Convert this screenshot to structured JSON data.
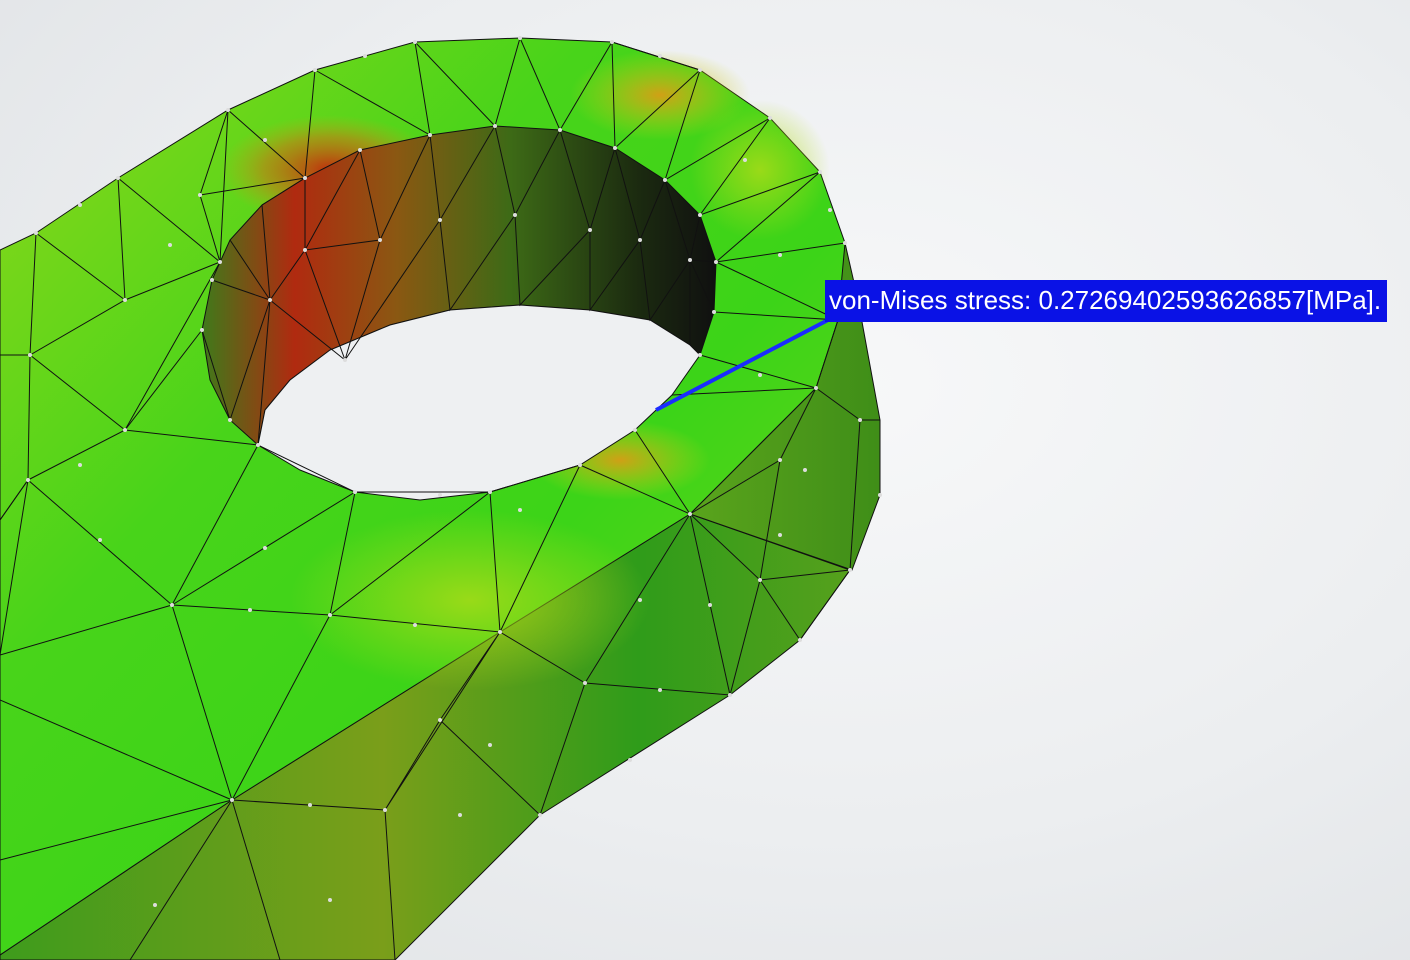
{
  "viewer": {
    "background": "#eceef0",
    "colors": {
      "low_stress": "#2fd41a",
      "mid_stress": "#a8d816",
      "high_stress": "#c0280e",
      "side_face": "#5aa21a",
      "mesh_line": "#111111",
      "node": "#dddddd",
      "probe_line": "#1a2cff",
      "probe_bg": "#0a12e6"
    }
  },
  "probe": {
    "label": "von-Mises stress: 0.27269402593626857[MPa]."
  }
}
